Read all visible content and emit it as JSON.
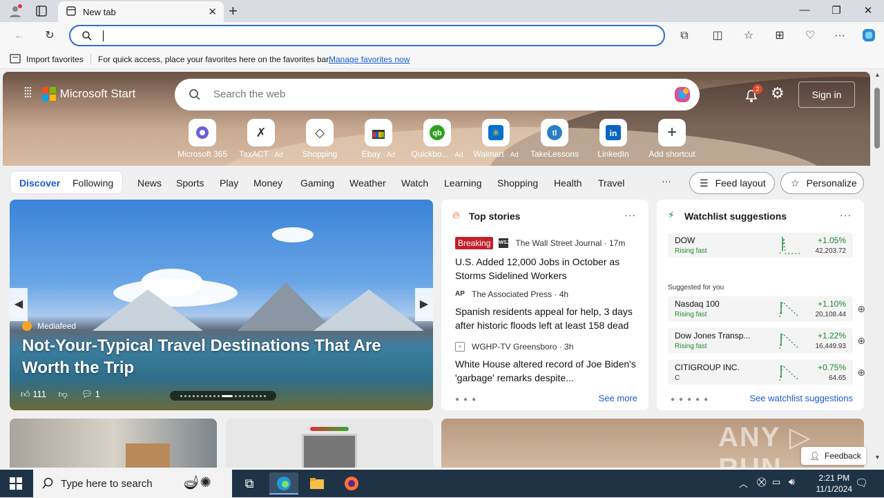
{
  "browser": {
    "tab_title": "New tab",
    "address_value": "",
    "favorites_bar": {
      "import_label": "Import favorites",
      "hint": "For quick access, place your favorites here on the favorites bar.",
      "manage_link": "Manage favorites now"
    }
  },
  "header": {
    "brand": "Microsoft Start",
    "search_placeholder": "Search the web",
    "notification_count": "2",
    "sign_in": "Sign in"
  },
  "shortcuts": [
    {
      "label": "Microsoft 365",
      "ad": ""
    },
    {
      "label": "TaxACT",
      "ad": "· Ad"
    },
    {
      "label": "Shopping",
      "ad": ""
    },
    {
      "label": "Ebay",
      "ad": "· Ad"
    },
    {
      "label": "Quickbo...",
      "ad": "· Ad"
    },
    {
      "label": "Walmart",
      "ad": "· Ad"
    },
    {
      "label": "TakeLessons",
      "ad": ""
    },
    {
      "label": "LinkedIn",
      "ad": ""
    },
    {
      "label": "Add shortcut",
      "ad": ""
    }
  ],
  "nav": {
    "discover": "Discover",
    "following": "Following",
    "items": [
      "News",
      "Sports",
      "Play",
      "Money",
      "Gaming",
      "Weather",
      "Watch",
      "Learning",
      "Shopping",
      "Health",
      "Travel"
    ],
    "more": "···",
    "feed_layout": "Feed layout",
    "personalize": "Personalize"
  },
  "feature": {
    "source": "Mediafeed",
    "headline": "Not-Your-Typical Travel Destinations That Are Worth the Trip",
    "likes": "111",
    "comments": "1"
  },
  "top_stories": {
    "title": "Top stories",
    "more": "···",
    "stories": [
      {
        "badge": "Breaking",
        "source": "The Wall Street Journal · 17m",
        "title": "U.S. Added 12,000 Jobs in October as Storms Sidelined Workers"
      },
      {
        "badge": "",
        "source": "The Associated Press · 4h",
        "title": "Spanish residents appeal for help, 3 days after historic floods left at least 158 dead"
      },
      {
        "badge": "",
        "source": "WGHP-TV Greensboro · 3h",
        "title": "White House altered record of Joe Biden's 'garbage' remarks despite..."
      }
    ],
    "see_more": "See more"
  },
  "watchlist": {
    "title": "Watchlist suggestions",
    "more": "···",
    "primary": {
      "symbol": "DOW",
      "status": "Rising fast",
      "change": "+1.05%",
      "price": "42,203.72"
    },
    "suggested_label": "Suggested for you",
    "suggested": [
      {
        "symbol": "Nasdaq 100",
        "status": "Rising fast",
        "change": "+1.10%",
        "price": "20,108.44"
      },
      {
        "symbol": "Dow Jones Transp...",
        "status": "Rising fast",
        "change": "+1.22%",
        "price": "16,449.93"
      },
      {
        "symbol": "CITIGROUP INC.",
        "status": "C",
        "change": "+0.75%",
        "price": "64.65"
      }
    ],
    "see_all": "See watchlist suggestions"
  },
  "feedback": "Feedback",
  "taskbar": {
    "search_placeholder": "Type here to search",
    "time": "2:21 PM",
    "date": "11/1/2024"
  },
  "colors": {
    "accent": "#2b6ed9",
    "positive": "#1a8a2e",
    "breaking": "#c4202a",
    "taskbar": "#1f3347"
  }
}
